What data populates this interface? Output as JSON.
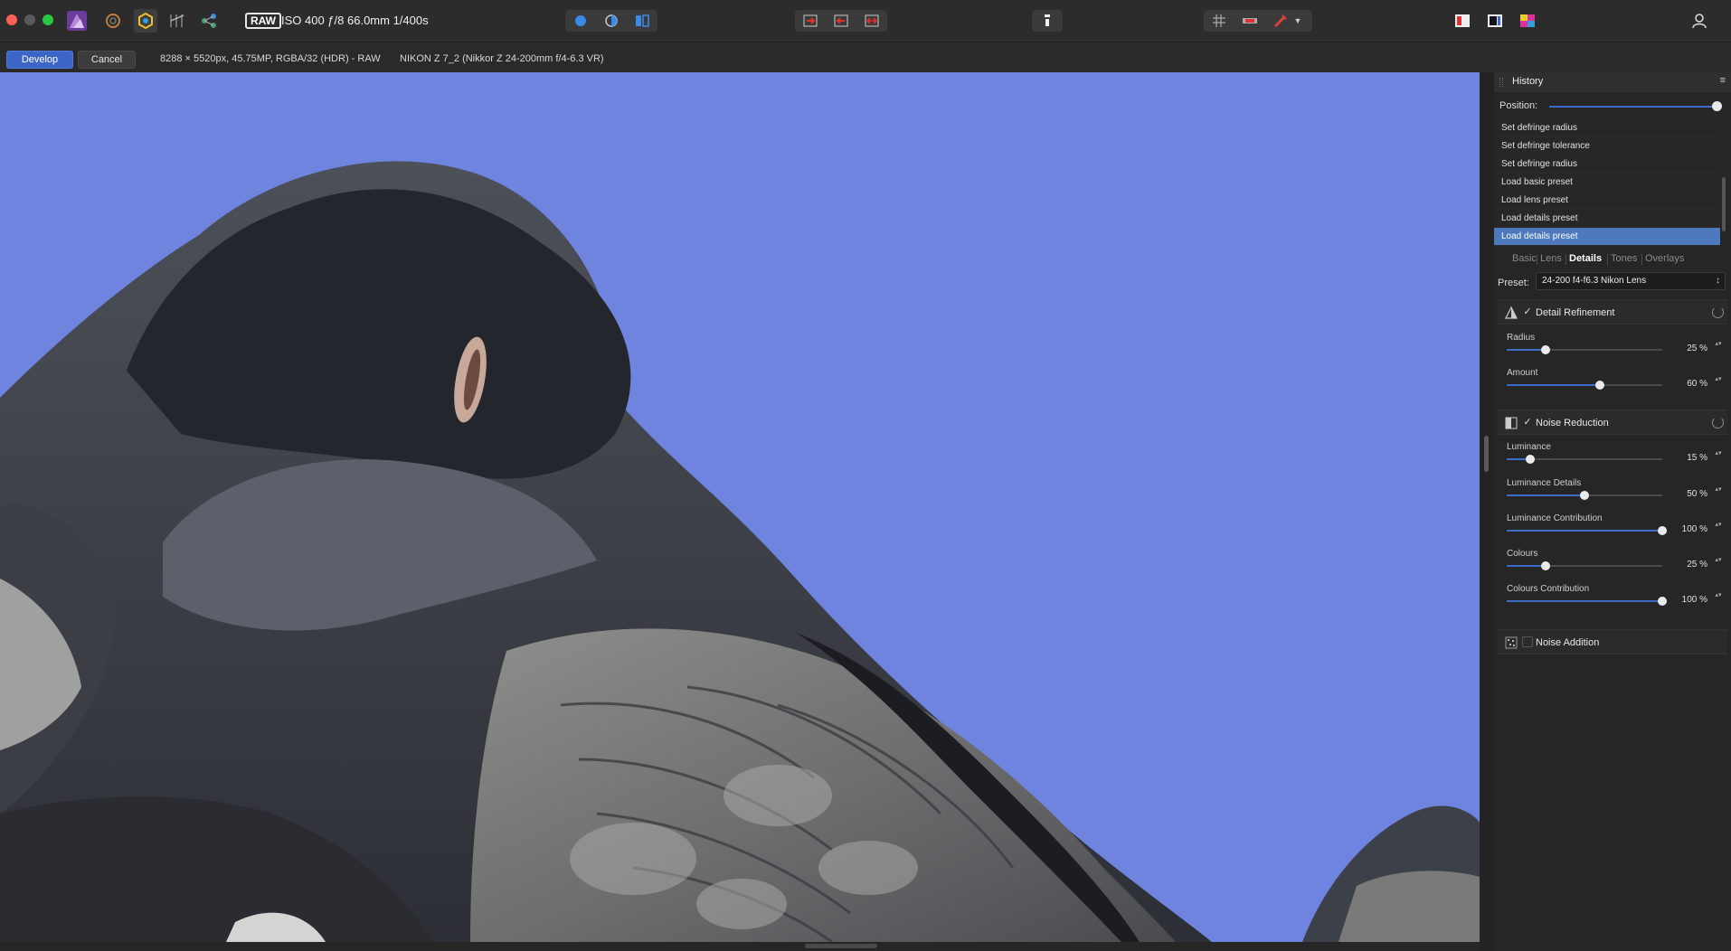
{
  "toolbar": {
    "raw_badge": "RAW",
    "exif": "ISO 400 ƒ/8 66.0mm 1/400s"
  },
  "context": {
    "develop_label": "Develop",
    "cancel_label": "Cancel",
    "image_info": "8288 × 5520px, 45.75MP, RGBA/32 (HDR) - RAW",
    "camera_info": "NIKON Z 7_2 (Nikkor Z 24-200mm f/4-6.3 VR)"
  },
  "history": {
    "title": "History",
    "menu_glyph": "≡",
    "position_label": "Position:",
    "items": [
      {
        "label": "Set defringe radius"
      },
      {
        "label": "Set defringe tolerance"
      },
      {
        "label": "Set defringe radius"
      },
      {
        "label": "Load basic preset"
      },
      {
        "label": "Load lens preset"
      },
      {
        "label": "Load details preset"
      },
      {
        "label": "Load details preset"
      }
    ]
  },
  "tabs": [
    "Basic",
    "Lens",
    "Details",
    "Tones",
    "Overlays"
  ],
  "preset": {
    "label": "Preset:",
    "value": "24-200 f4-f6.3 Nikon Lens"
  },
  "detail_refinement": {
    "title": "Detail Refinement",
    "check": "✓",
    "sliders": [
      {
        "label": "Radius",
        "value": "25 %",
        "level": 0.25
      },
      {
        "label": "Amount",
        "value": "60 %",
        "level": 0.6
      }
    ]
  },
  "noise_reduction": {
    "title": "Noise Reduction",
    "check": "✓",
    "sliders": [
      {
        "label": "Luminance",
        "value": "15 %",
        "level": 0.15
      },
      {
        "label": "Luminance Details",
        "value": "50 %",
        "level": 0.5
      },
      {
        "label": "Luminance Contribution",
        "value": "100 %",
        "level": 1.0
      },
      {
        "label": "Colours",
        "value": "25 %",
        "level": 0.25
      },
      {
        "label": "Colours Contribution",
        "value": "100 %",
        "level": 1.0
      }
    ]
  },
  "noise_addition": {
    "title": "Noise Addition"
  },
  "stepper_glyph": "▴▾",
  "select_arrow": "↕",
  "colors": {
    "accent": "#3c6bc8",
    "sky": "#6e84de",
    "selected_row": "#4e79bd"
  }
}
